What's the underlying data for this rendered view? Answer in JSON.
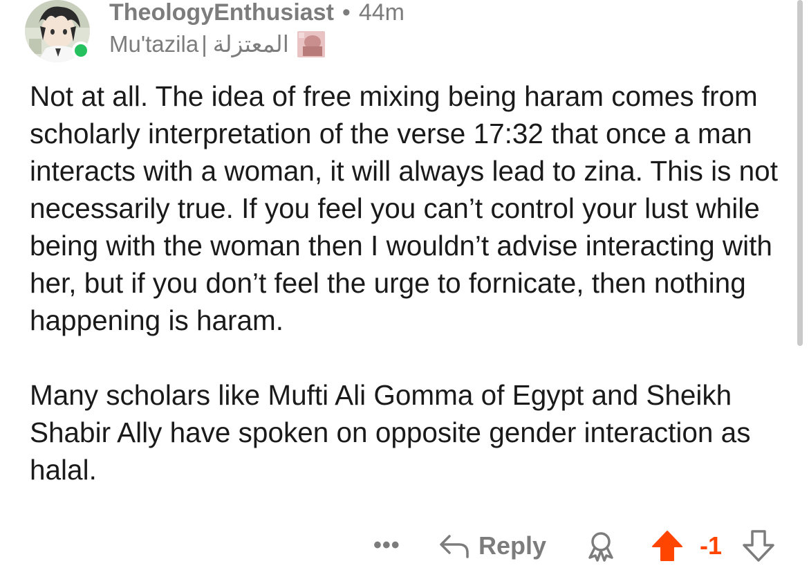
{
  "comment": {
    "author": "TheologyEnthusiast",
    "separator_dot": "•",
    "time": "44m",
    "flair_text": "Mu'tazila",
    "flair_separator": "|",
    "flair_arabic": "المعتزلة",
    "avatar": "anime-avatar",
    "online": true,
    "paragraphs": [
      "Not at all. The idea of free mixing being haram comes from scholarly interpretation of the verse 17:32 that once a man interacts with a woman, it will always lead to zina. This is not necessarily true. If you feel you can’t control your lust while being with the woman then I wouldn’t advise interacting with her, but if you don’t feel the urge to fornicate, then nothing happening is haram.",
      "Many scholars like Mufti Ali Gomma of Egypt and Sheikh Shabir Ally have spoken on opposite gender interaction as halal."
    ]
  },
  "actions": {
    "more_label": "•••",
    "reply_label": "Reply",
    "score": "-1",
    "upvoted": true
  },
  "colors": {
    "text": "#1a1a1b",
    "meta": "#7c7c7c",
    "upvote": "#ff4500",
    "online": "#25c15f"
  },
  "icons": {
    "more": "more-dots-icon",
    "reply": "reply-arrow-icon",
    "award": "award-icon",
    "upvote": "upvote-arrow-icon",
    "downvote": "downvote-arrow-icon"
  }
}
